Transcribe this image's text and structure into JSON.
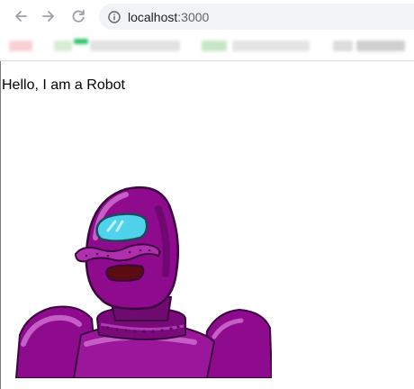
{
  "browser": {
    "address_host": "localhost",
    "address_port": ":3000",
    "icons": [
      "back-arrow-icon",
      "forward-arrow-icon",
      "reload-icon",
      "info-icon"
    ]
  },
  "bookmarks_bar": {
    "colors": [
      "#f9d0d4",
      "#d8ecd3",
      "#31c56b",
      "#e2e2e2",
      "#c7e7c4",
      "#dcdcdc",
      "#cfcfcf"
    ]
  },
  "page": {
    "heading": "Hello, I am a Robot",
    "image": "robot-illustration"
  },
  "colors": {
    "robot_purple": "#8e0b8e",
    "robot_purple_dark": "#5c075f",
    "robot_purple_light": "#c65ec8",
    "visor": "#4fd3ec",
    "mouth": "#5a0c12"
  }
}
